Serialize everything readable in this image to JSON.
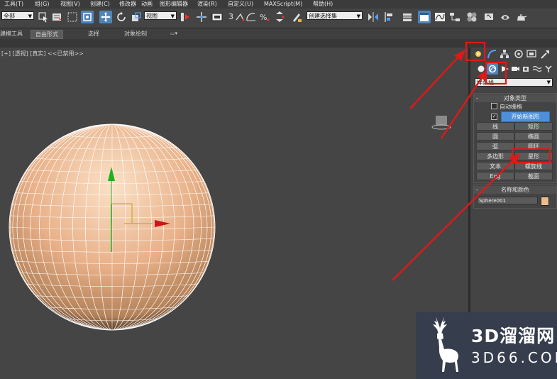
{
  "menu": [
    "工具(T)",
    "组(G)",
    "视图(V)",
    "创建(C)",
    "修改器",
    "动画",
    "图形编辑器",
    "渲染(R)",
    "自定义(U)",
    "MAXScript(M)",
    "帮助(H)"
  ],
  "toolbar": {
    "selection_filter": "全部",
    "reference_coord": "视图",
    "snap_value": "3",
    "named_selection": "创建选择集"
  },
  "ribbon": {
    "tabs": [
      "建模工具",
      "自由形式",
      "选择",
      "对象绘制"
    ]
  },
  "viewport": {
    "label": "[+] [透视] [真实] <<已禁用>>"
  },
  "command_panel": {
    "category_dropdown": "样条线",
    "object_type": {
      "title": "对象类型",
      "auto_grid": "自动栅格",
      "start_new_shape": "开始新图形",
      "start_new_shape_checked": true,
      "buttons": [
        "线",
        "矩形",
        "圆",
        "椭圆",
        "弧",
        "圆环",
        "多边形",
        "星形",
        "文本",
        "螺旋线",
        "Egg",
        "截面"
      ]
    },
    "name_color": {
      "title": "名称和颜色",
      "object_name": "Sphere001",
      "color": "#ecbc8e"
    }
  },
  "watermark": {
    "line1": "3D溜溜网",
    "line2": "3D66.COM"
  },
  "annotation_color": "#e01818"
}
